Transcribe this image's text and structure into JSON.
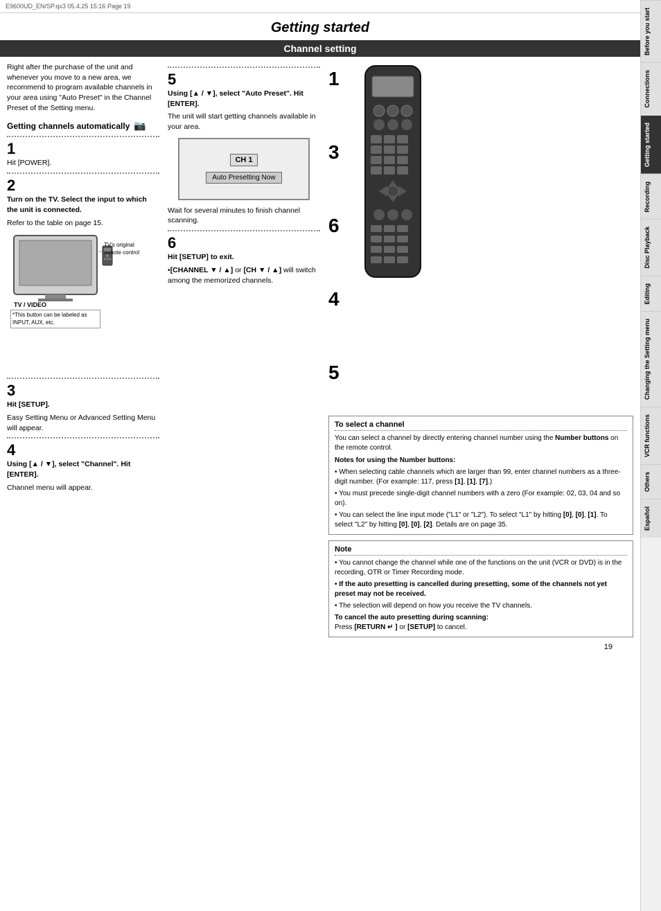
{
  "meta": {
    "file_info": "E9600UD_EN/SP.qx3   05.4.25 15:16   Page 19"
  },
  "page_title": "Getting started",
  "section_title": "Channel setting",
  "intro_text": "Right after the purchase of the unit and whenever you move to a new area, we recommend to program available channels in your area using \"Auto Preset\" in the Channel Preset of the Setting menu.",
  "subheading": "Getting channels automatically",
  "steps_left": [
    {
      "num": "1",
      "text": "Hit [POWER]."
    },
    {
      "num": "2",
      "text": "Turn on the TV. Select the input to which the unit is connected.",
      "note": "Refer to the table on page 15."
    },
    {
      "num": "3",
      "text": "Hit [SETUP].",
      "sub": "Easy Setting Menu or Advanced Setting Menu will appear."
    },
    {
      "num": "4",
      "text": "Using [▲ / ▼], select \"Channel\". Hit [ENTER].",
      "sub": "Channel menu will appear."
    }
  ],
  "steps_middle": [
    {
      "num": "5",
      "text": "Using [▲ / ▼], select \"Auto Preset\". Hit [ENTER].",
      "sub": "The unit will start getting channels available in your area.",
      "screen": {
        "ch_label": "CH 1",
        "btn_label": "Auto Presetting Now"
      },
      "wait_text": "Wait for several minutes to finish channel scanning."
    },
    {
      "num": "6",
      "text": "Hit [SETUP] to exit.",
      "bullets": [
        "•[CHANNEL ▼ / ▲] or [CH ▼ / ▲] will switch among the memorized channels."
      ]
    }
  ],
  "to_select_channel": {
    "title": "To select a channel",
    "text1": "You can select a channel by directly entering channel number using the Number buttons on the remote control.",
    "heading2": "Notes for using the Number buttons:",
    "bullets": [
      "• When selecting cable channels which are larger than 99, enter channel numbers as a three-digit number. (For example: 117, press [1], [1], [7].)",
      "• You must precede single-digit channel numbers with a zero (For example: 02, 03, 04 and so on).",
      "• You can select the line input mode (\"L1\" or \"L2\"). To select \"L1\" by hitting [0], [0], [1]. To select \"L2\" by hitting [0], [0], [2]. Details are on page 35."
    ]
  },
  "note_box": {
    "title": "Note",
    "bullets": [
      "• You cannot change the channel while one of the functions on the unit (VCR or DVD) is in the recording, OTR or Timer Recording mode.",
      "• If the auto presetting is cancelled during presetting, some of the channels not yet preset may not be received.",
      "• The selection will depend on how you receive the TV channels.",
      "To cancel the auto presetting during scanning: Press [RETURN ↵ ] or [SETUP] to cancel."
    ]
  },
  "step_numbers_right": [
    "1",
    "3",
    "6",
    "4",
    "5"
  ],
  "page_number": "19",
  "sidebar_tabs": [
    "Before you start",
    "Connections",
    "Getting started",
    "Recording",
    "Disc Playback",
    "Editing",
    "Changing the Setting menu",
    "VCR functions",
    "Others",
    "Español"
  ],
  "tv_labels": {
    "remote_label": "TV's original remote control",
    "input_label": "TV / VIDEO",
    "note_label": "*This button can be labeled as INPUT, AUX, etc."
  }
}
